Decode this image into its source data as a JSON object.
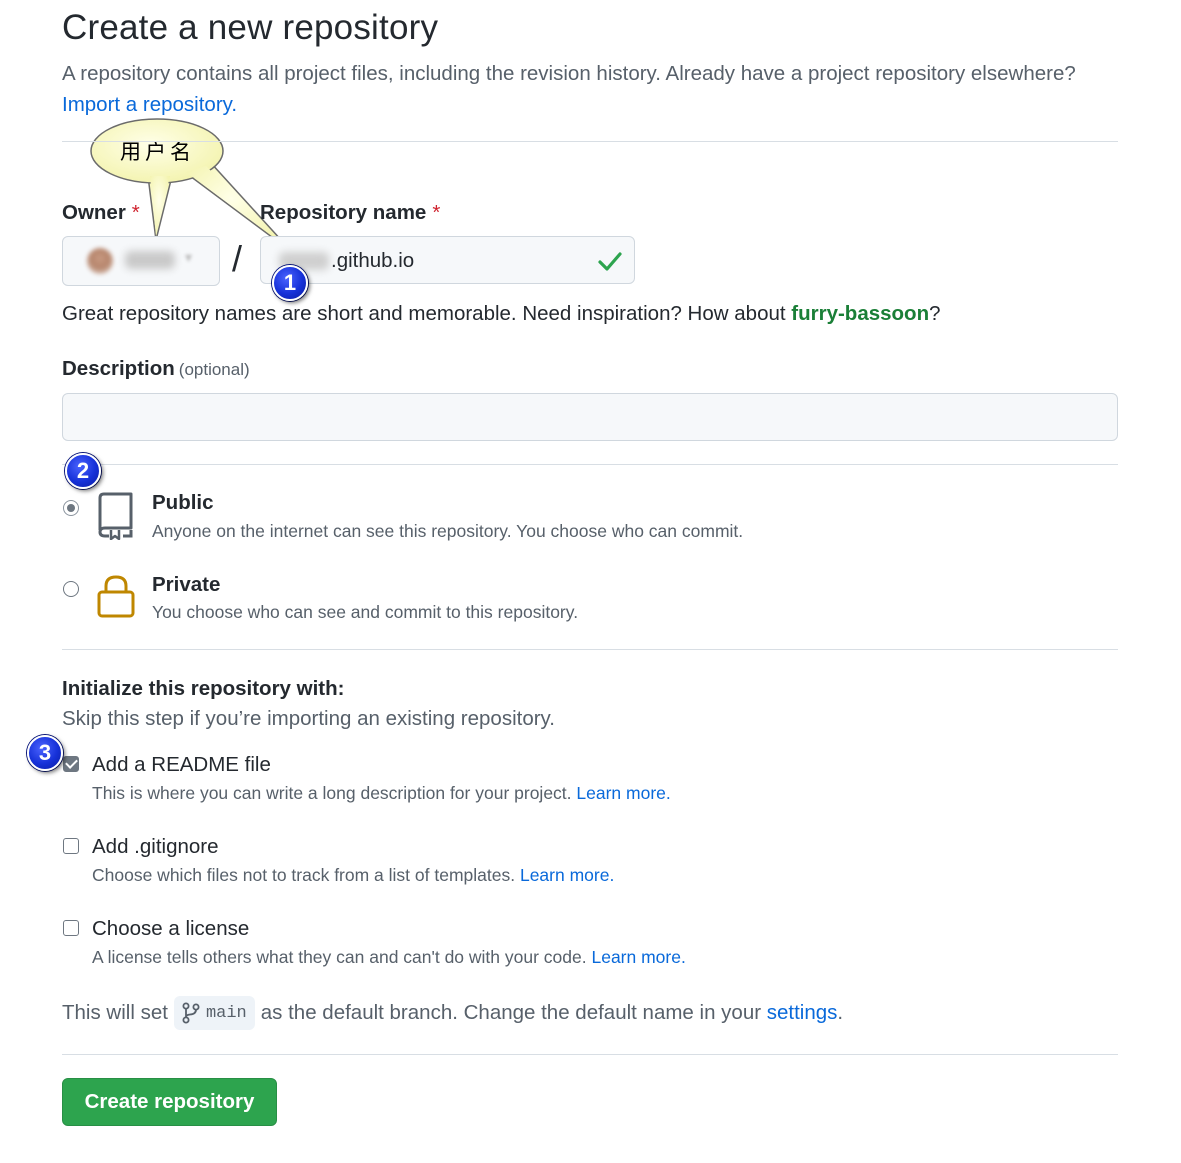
{
  "header": {
    "title": "Create a new repository",
    "subtitle": "A repository contains all project files, including the revision history. Already have a project repository elsewhere?",
    "import_link": "Import a repository."
  },
  "owner": {
    "label": "Owner",
    "required_mark": "*"
  },
  "separator": "/",
  "repo_name": {
    "label": "Repository name",
    "required_mark": "*",
    "value": ".github.io"
  },
  "name_hint": {
    "text": "Great repository names are short and memorable. Need inspiration? How about ",
    "suggestion": "furry-bassoon",
    "end": "?"
  },
  "description": {
    "label": "Description",
    "optional": "(optional)",
    "value": ""
  },
  "visibility": {
    "selected": "public",
    "public": {
      "title": "Public",
      "desc": "Anyone on the internet can see this repository. You choose who can commit."
    },
    "private": {
      "title": "Private",
      "desc": "You choose who can see and commit to this repository."
    }
  },
  "init": {
    "title": "Initialize this repository with:",
    "subtitle": "Skip this step if you’re importing an existing repository.",
    "readme": {
      "title": "Add a README file",
      "desc": "This is where you can write a long description for your project.",
      "link": "Learn more.",
      "checked": true
    },
    "gitignore": {
      "title": "Add .gitignore",
      "desc": "Choose which files not to track from a list of templates.",
      "link": "Learn more.",
      "checked": false
    },
    "license": {
      "title": "Choose a license",
      "desc": "A license tells others what they can and can't do with your code.",
      "link": "Learn more.",
      "checked": false
    }
  },
  "branch": {
    "prefix": "This will set",
    "name": "main",
    "middle": "as the default branch. Change the default name in your",
    "settings_link": "settings",
    "end": "."
  },
  "submit": {
    "label": "Create repository"
  },
  "annotations": {
    "callout_text": "用户名",
    "badges": [
      "1",
      "2",
      "3"
    ],
    "badge_color": "#1631d8",
    "callout_color": "#ffffc0"
  },
  "colors": {
    "primary_button": "#2da44e",
    "link": "#0969da",
    "suggestion": "#1a7f37",
    "required": "#cf222e",
    "lock_icon": "#bf8700",
    "valid_check": "#2da44e"
  }
}
